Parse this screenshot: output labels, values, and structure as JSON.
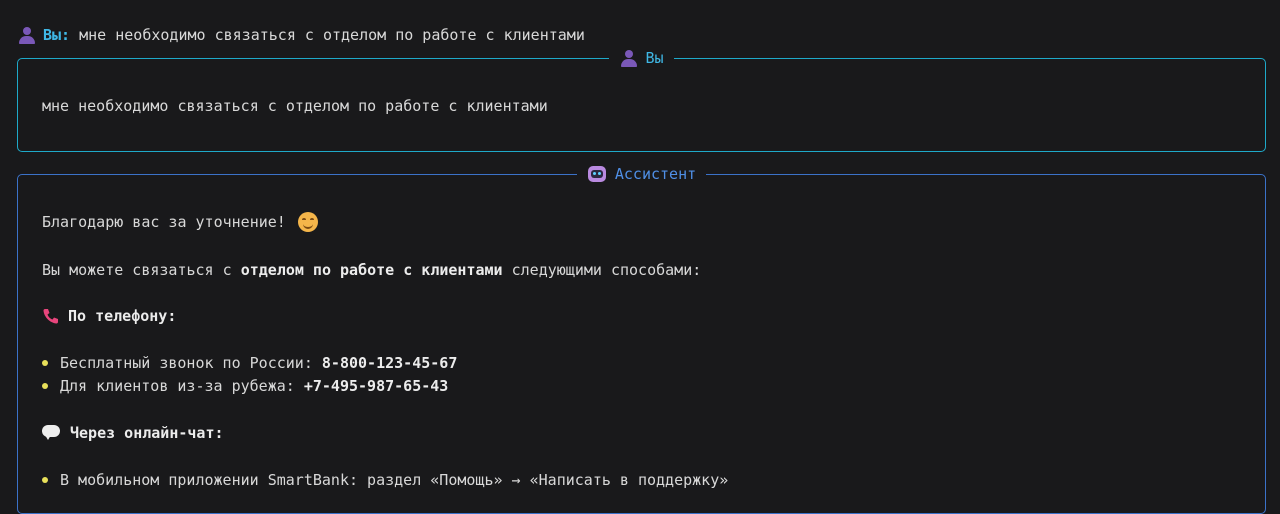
{
  "prompt": {
    "label": "Вы:",
    "text": " мне необходимо связаться с отделом по работе с клиентами"
  },
  "user_panel": {
    "title": "Вы",
    "message": "мне необходимо связаться с отделом по работе с клиентами"
  },
  "assistant_panel": {
    "title": "Ассистент",
    "thanks": "Благодарю вас за уточнение!",
    "intro_pre": "Вы можете связаться с ",
    "intro_bold": "отделом по работе с клиентами",
    "intro_post": " следующими способами:",
    "phone_heading": "По телефону:",
    "phone_items": [
      {
        "label": "Бесплатный звонок по России: ",
        "value": "8-800-123-45-67"
      },
      {
        "label": "Для клиентов из-за рубежа: ",
        "value": "+7-495-987-65-43"
      }
    ],
    "chat_heading": "Через онлайн-чат:",
    "chat_items": [
      {
        "text": "В мобильном приложении SmartBank: раздел «Помощь» → «Написать в поддержку»"
      }
    ]
  },
  "colors": {
    "background": "#19191b",
    "user_accent": "#1ea9c9",
    "assistant_accent": "#3b72c9",
    "bullet": "#e8e05a"
  },
  "icons": [
    "user-icon",
    "robot-icon",
    "smile-emoji-icon",
    "phone-icon",
    "speech-bubble-icon"
  ]
}
